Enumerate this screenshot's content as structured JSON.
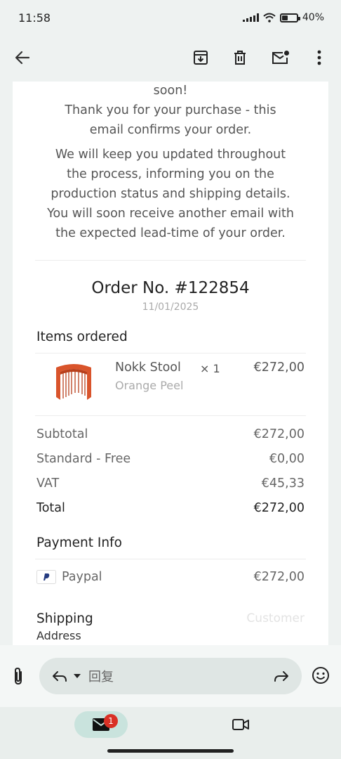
{
  "status_bar": {
    "time": "11:58",
    "battery_percent": "40%",
    "battery_level": 0.4
  },
  "toolbar": {
    "back_icon": "arrow-left-icon",
    "archive_icon": "archive-icon",
    "delete_icon": "trash-icon",
    "mark_unread_icon": "mail-unread-icon",
    "more_icon": "more-vert-icon"
  },
  "email": {
    "intro_fragment": "soon!",
    "thanks_text": "Thank you for your purchase - this email confirms your order.",
    "update_text": "We will keep you updated throughout the process, informing you on the production status and shipping details. You will soon receive another email with the expected lead-time of your order.",
    "order_title": "Order No. #122854",
    "order_date": "11/01/2025",
    "items_title": "Items ordered",
    "items": [
      {
        "name": "Nokk Stool",
        "variant": "Orange Peel",
        "qty": "× 1",
        "price": "€272,00"
      }
    ],
    "summary": [
      {
        "label": "Subtotal",
        "value": "€272,00"
      },
      {
        "label": "Standard - Free",
        "value": "€0,00"
      },
      {
        "label": "VAT",
        "value": "€45,33"
      },
      {
        "label": "Total",
        "value": "€272,00"
      }
    ],
    "payment_title": "Payment Info",
    "payment_method": "Paypal",
    "payment_amount": "€272,00",
    "shipping_title": "Shipping",
    "shipping_subtitle": "Address",
    "shipping_right": "Customer"
  },
  "reply_bar": {
    "attach_icon": "paperclip-icon",
    "reply_icon": "reply-icon",
    "placeholder": "回复",
    "forward_icon": "forward-icon",
    "emoji_icon": "emoji-icon"
  },
  "bottom_nav": {
    "mail_badge": "1",
    "mail_icon": "mail-icon",
    "meet_icon": "video-icon"
  },
  "colors": {
    "accent_pill": "#c9e3dd",
    "badge": "#d93025",
    "product": "#d9542b"
  }
}
